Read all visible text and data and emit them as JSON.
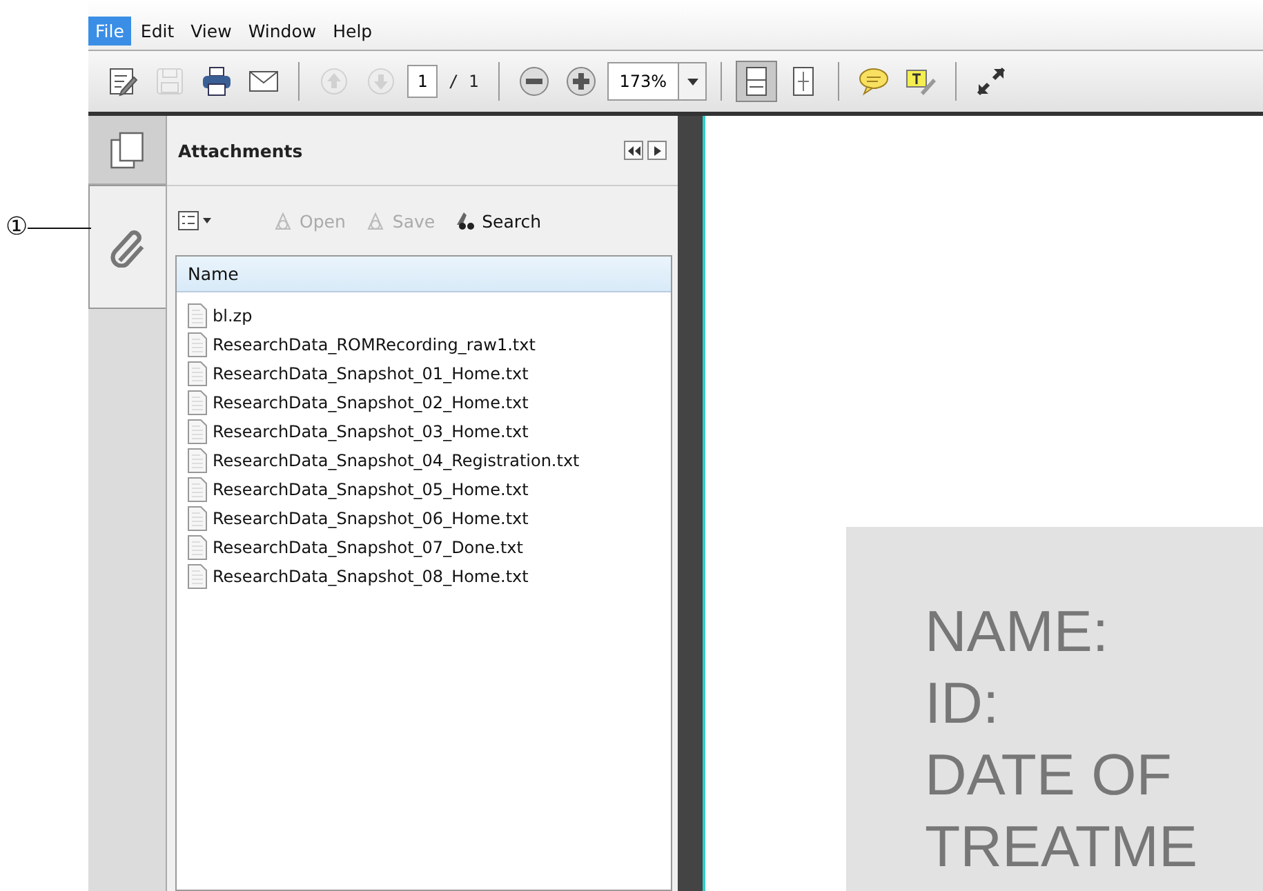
{
  "callout": {
    "label": "①"
  },
  "menu": [
    {
      "label": "File",
      "selected": true
    },
    {
      "label": "Edit",
      "selected": false
    },
    {
      "label": "View",
      "selected": false
    },
    {
      "label": "Window",
      "selected": false
    },
    {
      "label": "Help",
      "selected": false
    }
  ],
  "toolbar": {
    "groups": [
      [
        {
          "kind": "edit",
          "disabled": false,
          "selected": false
        },
        {
          "kind": "save",
          "disabled": true,
          "selected": false
        },
        {
          "kind": "print",
          "disabled": false,
          "selected": false
        },
        {
          "kind": "email",
          "disabled": false,
          "selected": false
        }
      ],
      [
        {
          "kind": "prev",
          "disabled": true,
          "selected": false
        },
        {
          "kind": "next",
          "disabled": true,
          "selected": false
        }
      ],
      [
        {
          "kind": "zoomout",
          "disabled": false,
          "selected": false
        },
        {
          "kind": "zoomin",
          "disabled": false,
          "selected": false
        }
      ],
      [
        {
          "kind": "fitwidth",
          "disabled": false,
          "selected": true
        },
        {
          "kind": "fitpage",
          "disabled": false,
          "selected": false
        }
      ],
      [
        {
          "kind": "comment",
          "disabled": false,
          "selected": false
        },
        {
          "kind": "highlight",
          "disabled": false,
          "selected": false
        }
      ],
      [
        {
          "kind": "expand",
          "disabled": false,
          "selected": false
        }
      ]
    ],
    "page_number": "1",
    "page_total": "/ 1",
    "zoom": "173%"
  },
  "nav": [
    {
      "kind": "pages",
      "selected": false
    },
    {
      "kind": "attachments",
      "selected": true
    }
  ],
  "panel": {
    "title": "Attachments",
    "actions": [
      {
        "label": "Open",
        "disabled": true
      },
      {
        "label": "Save",
        "disabled": true
      },
      {
        "label": "Search",
        "disabled": false
      }
    ],
    "column": "Name",
    "files": [
      {
        "name": "bl.zp"
      },
      {
        "name": "ResearchData_ROMRecording_raw1.txt"
      },
      {
        "name": "ResearchData_Snapshot_01_Home.txt"
      },
      {
        "name": "ResearchData_Snapshot_02_Home.txt"
      },
      {
        "name": "ResearchData_Snapshot_03_Home.txt"
      },
      {
        "name": "ResearchData_Snapshot_04_Registration.txt"
      },
      {
        "name": "ResearchData_Snapshot_05_Home.txt"
      },
      {
        "name": "ResearchData_Snapshot_06_Home.txt"
      },
      {
        "name": "ResearchData_Snapshot_07_Done.txt"
      },
      {
        "name": "ResearchData_Snapshot_08_Home.txt"
      }
    ]
  },
  "document": {
    "lines": [
      "NAME:",
      "ID:",
      "DATE OF",
      "TREATME"
    ]
  }
}
